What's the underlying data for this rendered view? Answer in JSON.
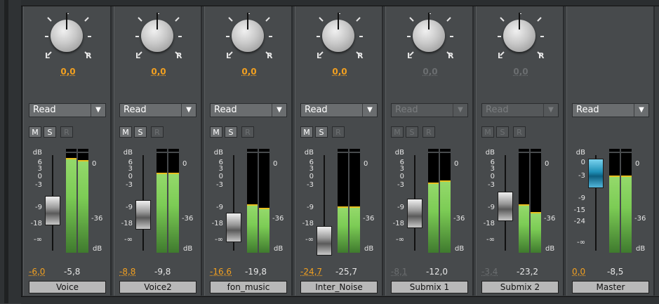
{
  "pan_labels": {
    "left": "L",
    "right": "R"
  },
  "scale_labels": {
    "db": "dB",
    "zero": "0",
    "minus36": "-36",
    "db_bottom": "dB"
  },
  "buttons": {
    "mute": "M",
    "solo": "S",
    "record": "R"
  },
  "colors": {
    "accent_value": "#f2a020",
    "meter_green": "#7ccc55",
    "peak_yellow": "#e8c020",
    "master_fader": "#1e8fb6"
  },
  "channels": [
    {
      "name": "Voice",
      "pan": "0,0",
      "mode": "Read",
      "volume": "-6,0",
      "peak": "-5,8",
      "enabled": true,
      "has_buttons": true,
      "fader_scale": [
        "6",
        "3",
        "0",
        "-3",
        "-9",
        "-18",
        "-∞"
      ],
      "meter_levels": [
        0.95,
        0.93
      ]
    },
    {
      "name": "Voice2",
      "pan": "0,0",
      "mode": "Read",
      "volume": "-8,8",
      "peak": "-9,8",
      "enabled": true,
      "has_buttons": true,
      "fader_scale": [
        "6",
        "3",
        "0",
        "-3",
        "-9",
        "-18",
        "-∞"
      ],
      "meter_levels": [
        0.8,
        0.8
      ]
    },
    {
      "name": "fon_music",
      "pan": "0,0",
      "mode": "Read",
      "volume": "-16,6",
      "peak": "-19,8",
      "enabled": true,
      "has_buttons": true,
      "fader_scale": [
        "6",
        "3",
        "0",
        "-3",
        "-9",
        "-18",
        "-∞"
      ],
      "meter_levels": [
        0.48,
        0.44
      ]
    },
    {
      "name": "Inter_Noise",
      "pan": "0,0",
      "mode": "Read",
      "volume": "-24,7",
      "peak": "-25,7",
      "enabled": true,
      "has_buttons": true,
      "fader_scale": [
        "6",
        "3",
        "0",
        "-3",
        "-9",
        "-18",
        "-∞"
      ],
      "meter_levels": [
        0.46,
        0.46
      ]
    },
    {
      "name": "Submix 1",
      "pan": "0,0",
      "mode": "Read",
      "volume": "-8,1",
      "peak": "-12,0",
      "enabled": false,
      "has_buttons": true,
      "fader_scale": [
        "6",
        "3",
        "0",
        "-3",
        "-9",
        "-18",
        "-∞"
      ],
      "meter_levels": [
        0.7,
        0.72
      ]
    },
    {
      "name": "Submix 2",
      "pan": "0,0",
      "mode": "Read",
      "volume": "-3,4",
      "peak": "-23,2",
      "enabled": false,
      "has_buttons": true,
      "fader_scale": [
        "6",
        "3",
        "0",
        "-3",
        "-9",
        "-18",
        "-∞"
      ],
      "meter_levels": [
        0.48,
        0.4
      ]
    },
    {
      "name": "Master",
      "pan": "",
      "mode": "Read",
      "volume": "0,0",
      "peak": "-8,5",
      "enabled": true,
      "has_buttons": false,
      "fader_scale": [
        "0",
        "-3",
        "-9",
        "-15",
        "-24",
        "-∞"
      ],
      "meter_levels": [
        0.77,
        0.77
      ]
    }
  ]
}
